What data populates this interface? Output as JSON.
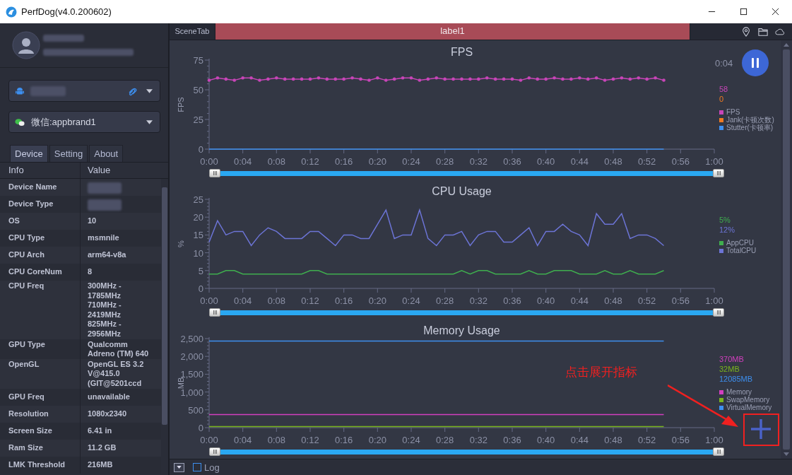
{
  "window": {
    "title": "PerfDog(v4.0.200602)"
  },
  "sidebar": {
    "device_selector": {
      "kind": "android"
    },
    "app_selector": {
      "label": "微信:appbrand1"
    },
    "tabs": [
      {
        "label": "Device",
        "selected": true
      },
      {
        "label": "Setting",
        "selected": false
      },
      {
        "label": "About",
        "selected": false
      }
    ],
    "table": {
      "columns": [
        "Info",
        "Value"
      ],
      "rows": [
        {
          "info": "Device Name",
          "kind": "blurred"
        },
        {
          "info": "Device Type",
          "kind": "blurred"
        },
        {
          "info": "OS",
          "kind": "text",
          "value": [
            "10"
          ]
        },
        {
          "info": "CPU Type",
          "kind": "text",
          "value": [
            "msmnile"
          ]
        },
        {
          "info": "CPU Arch",
          "kind": "text",
          "value": [
            "arm64-v8a"
          ]
        },
        {
          "info": "CPU CoreNum",
          "kind": "text",
          "value": [
            "8"
          ]
        },
        {
          "info": "CPU Freq",
          "kind": "text",
          "value": [
            "300MHz -",
            "1785MHz",
            "710MHz -",
            "2419MHz",
            "825MHz -",
            "2956MHz"
          ]
        },
        {
          "info": "GPU Type",
          "kind": "text",
          "value": [
            "Qualcomm",
            "Adreno (TM) 640"
          ]
        },
        {
          "info": "OpenGL",
          "kind": "text",
          "value": [
            "OpenGL ES 3.2",
            "V@415.0",
            "(GIT@5201ccd"
          ]
        },
        {
          "info": "GPU Freq",
          "kind": "text",
          "value": [
            "unavailable"
          ]
        },
        {
          "info": "Resolution",
          "kind": "text",
          "value": [
            "1080x2340"
          ]
        },
        {
          "info": "Screen Size",
          "kind": "text",
          "value": [
            "6.41 in"
          ]
        },
        {
          "info": "Ram Size",
          "kind": "text",
          "value": [
            "11.2 GB"
          ]
        },
        {
          "info": "LMK Threshold",
          "kind": "text",
          "value": [
            "216MB"
          ]
        }
      ]
    }
  },
  "scene_bar": {
    "tab": "SceneTab",
    "label": "label1"
  },
  "charts": [
    {
      "controls": [
        {
          "kind": "timer",
          "text": "0:04"
        },
        {
          "kind": "pause"
        }
      ],
      "markers": true,
      "slider": {
        "level": 1
      },
      "readings": [
        "58",
        "0"
      ],
      "chart_data": {
        "type": "line",
        "title": "FPS",
        "ylabel": "FPS",
        "x": [
          0,
          1,
          2,
          3,
          4,
          5,
          6,
          7,
          8,
          9,
          10,
          11,
          12,
          13,
          14,
          15,
          16,
          17,
          18,
          19,
          20,
          21,
          22,
          23,
          24,
          25,
          26,
          27,
          28,
          29,
          30,
          31,
          32,
          33,
          34,
          35,
          36,
          37,
          38,
          39,
          40,
          41,
          42,
          43,
          44,
          45,
          46,
          47,
          48,
          49,
          50,
          51,
          52,
          53,
          54
        ],
        "xlim": [
          0,
          60
        ],
        "ylim": [
          0,
          75
        ],
        "yticks": [
          0,
          25,
          50,
          75
        ],
        "xticks": [
          {
            "value": 0,
            "label": "0:00"
          },
          {
            "value": 4,
            "label": "0:04"
          },
          {
            "value": 8,
            "label": "0:08"
          },
          {
            "value": 12,
            "label": "0:12"
          },
          {
            "value": 16,
            "label": "0:16"
          },
          {
            "value": 20,
            "label": "0:20"
          },
          {
            "value": 24,
            "label": "0:24"
          },
          {
            "value": 28,
            "label": "0:28"
          },
          {
            "value": 32,
            "label": "0:32"
          },
          {
            "value": 36,
            "label": "0:36"
          },
          {
            "value": 40,
            "label": "0:40"
          },
          {
            "value": 44,
            "label": "0:44"
          },
          {
            "value": 48,
            "label": "0:48"
          },
          {
            "value": 52,
            "label": "0:52"
          },
          {
            "value": 56,
            "label": "0:56"
          },
          {
            "value": 60,
            "label": "1:00"
          }
        ],
        "series": [
          {
            "name": "FPS",
            "color": "#c845b8",
            "values": [
              58,
              60,
              59,
              58,
              60,
              60,
              58,
              59,
              60,
              59,
              59,
              59,
              59,
              60,
              59,
              59,
              59,
              60,
              59,
              58,
              60,
              58,
              59,
              60,
              60,
              58,
              59,
              60,
              59,
              59,
              59,
              59,
              59,
              60,
              59,
              59,
              59,
              58,
              60,
              59,
              59,
              60,
              59,
              59,
              60,
              59,
              60,
              58,
              59,
              60,
              59,
              60,
              59,
              60,
              58
            ]
          },
          {
            "name": "Jank(卡顿次数)",
            "color": "#f07a22",
            "values": [
              null,
              null,
              null,
              null,
              null,
              null,
              null,
              null,
              null,
              null,
              null,
              null,
              null,
              null,
              null,
              null,
              null,
              null,
              null,
              null,
              null,
              null,
              null,
              null,
              null,
              null,
              null,
              null,
              null,
              null,
              null,
              null,
              null,
              null,
              null,
              null,
              null,
              null,
              null,
              null,
              null,
              null,
              null,
              null,
              null,
              null,
              null,
              null,
              null,
              null,
              null,
              null,
              null,
              null,
              null
            ]
          },
          {
            "name": "Stutter(卡顿率)",
            "color": "#3d8fef",
            "values": [
              0,
              0,
              0,
              0,
              0,
              0,
              0,
              0,
              0,
              0,
              0,
              0,
              0,
              0,
              0,
              0,
              0,
              0,
              0,
              0,
              0,
              0,
              0,
              0,
              0,
              0,
              0,
              0,
              0,
              0,
              0,
              0,
              0,
              0,
              0,
              0,
              0,
              0,
              0,
              0,
              0,
              0,
              0,
              0,
              0,
              0,
              0,
              0,
              0,
              0,
              0,
              0,
              0,
              0,
              0
            ]
          }
        ]
      }
    },
    {
      "slider": {
        "level": 1
      },
      "readings": [
        "5%",
        "12%"
      ],
      "chart_data": {
        "type": "line",
        "title": "CPU Usage",
        "ylabel": "%",
        "x": [
          0,
          1,
          2,
          3,
          4,
          5,
          6,
          7,
          8,
          9,
          10,
          11,
          12,
          13,
          14,
          15,
          16,
          17,
          18,
          19,
          20,
          21,
          22,
          23,
          24,
          25,
          26,
          27,
          28,
          29,
          30,
          31,
          32,
          33,
          34,
          35,
          36,
          37,
          38,
          39,
          40,
          41,
          42,
          43,
          44,
          45,
          46,
          47,
          48,
          49,
          50,
          51,
          52,
          53,
          54
        ],
        "xlim": [
          0,
          60
        ],
        "ylim": [
          0,
          25
        ],
        "yticks": [
          0,
          5,
          10,
          15,
          20,
          25
        ],
        "xticks": [
          {
            "value": 0,
            "label": "0:00"
          },
          {
            "value": 4,
            "label": "0:04"
          },
          {
            "value": 8,
            "label": "0:08"
          },
          {
            "value": 12,
            "label": "0:12"
          },
          {
            "value": 16,
            "label": "0:16"
          },
          {
            "value": 20,
            "label": "0:20"
          },
          {
            "value": 24,
            "label": "0:24"
          },
          {
            "value": 28,
            "label": "0:28"
          },
          {
            "value": 32,
            "label": "0:32"
          },
          {
            "value": 36,
            "label": "0:36"
          },
          {
            "value": 40,
            "label": "0:40"
          },
          {
            "value": 44,
            "label": "0:44"
          },
          {
            "value": 48,
            "label": "0:48"
          },
          {
            "value": 52,
            "label": "0:52"
          },
          {
            "value": 56,
            "label": "0:56"
          },
          {
            "value": 60,
            "label": "1:00"
          }
        ],
        "series": [
          {
            "name": "AppCPU",
            "color": "#3fae4e",
            "values": [
              4,
              4,
              5,
              5,
              4,
              4,
              4,
              4,
              4,
              4,
              4,
              4,
              5,
              5,
              4,
              4,
              4,
              4,
              4,
              4,
              4,
              4,
              4,
              4,
              4,
              4,
              4,
              4,
              4,
              4,
              5,
              4,
              5,
              5,
              4,
              4,
              4,
              4,
              5,
              4,
              4,
              5,
              5,
              5,
              4,
              4,
              4,
              5,
              4,
              4,
              5,
              4,
              4,
              4,
              5
            ]
          },
          {
            "name": "TotalCPU",
            "color": "#6c74d6",
            "values": [
              13,
              19,
              15,
              16,
              16,
              12,
              15,
              17,
              16,
              14,
              14,
              14,
              16,
              16,
              14,
              12,
              15,
              15,
              14,
              14,
              18,
              22,
              14,
              15,
              15,
              22,
              14,
              12,
              15,
              15,
              16,
              12,
              15,
              16,
              16,
              13,
              13,
              15,
              17,
              12,
              16,
              16,
              18,
              16,
              15,
              12,
              21,
              18,
              18,
              21,
              14,
              15,
              15,
              14,
              12
            ]
          }
        ]
      }
    },
    {
      "controls": [
        {
          "kind": "add"
        }
      ],
      "slider": {
        "level": 1
      },
      "readings": [
        "370MB",
        "32MB",
        "12085MB"
      ],
      "chart_data": {
        "type": "line",
        "title": "Memory Usage",
        "ylabel": "MB",
        "x": [
          0,
          54
        ],
        "xlim": [
          0,
          60
        ],
        "ylim": [
          0,
          2500
        ],
        "yticks": [
          {
            "value": 0,
            "label": "0"
          },
          {
            "value": 500,
            "label": "500"
          },
          {
            "value": 1000,
            "label": "1,000"
          },
          {
            "value": 1500,
            "label": "1,500"
          },
          {
            "value": 2000,
            "label": "2,000"
          },
          {
            "value": 2500,
            "label": "2,500"
          }
        ],
        "xticks": [
          {
            "value": 0,
            "label": "0:00"
          },
          {
            "value": 4,
            "label": "0:04"
          },
          {
            "value": 8,
            "label": "0:08"
          },
          {
            "value": 12,
            "label": "0:12"
          },
          {
            "value": 16,
            "label": "0:16"
          },
          {
            "value": 20,
            "label": "0:20"
          },
          {
            "value": 24,
            "label": "0:24"
          },
          {
            "value": 28,
            "label": "0:28"
          },
          {
            "value": 32,
            "label": "0:32"
          },
          {
            "value": 36,
            "label": "0:36"
          },
          {
            "value": 40,
            "label": "0:40"
          },
          {
            "value": 44,
            "label": "0:44"
          },
          {
            "value": 48,
            "label": "0:48"
          },
          {
            "value": 52,
            "label": "0:52"
          },
          {
            "value": 56,
            "label": "0:56"
          },
          {
            "value": 60,
            "label": "1:00"
          }
        ],
        "series": [
          {
            "name": "Memory",
            "color": "#d23fbf",
            "values": [
              370,
              370
            ]
          },
          {
            "name": "SwapMemory",
            "color": "#7ab51d",
            "values": [
              30,
              30
            ]
          },
          {
            "name": "VirtualMemory",
            "color": "#3d8fef",
            "values": [
              2430,
              2430
            ]
          }
        ]
      }
    }
  ],
  "annotation": {
    "text": "点击展开指标"
  },
  "bottom_bar": {
    "log": {
      "label": "Log",
      "checked": false
    }
  }
}
